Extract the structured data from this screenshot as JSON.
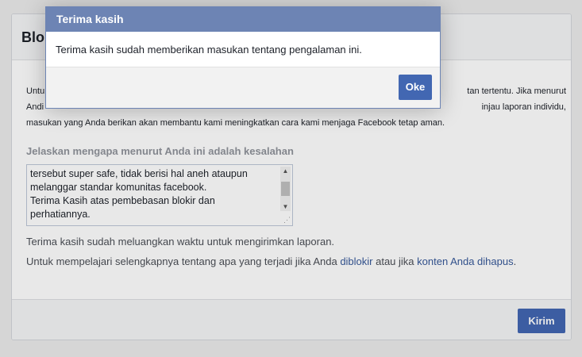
{
  "page": {
    "title": "Blo",
    "description_lines": [
      "Untu",
      "Andi",
      "masukan yang Anda berikan akan membantu kami meningkatkan cara kami menjaga Facebook tetap aman."
    ],
    "description_right": [
      "tan tertentu. Jika menurut",
      "injau laporan individu,"
    ],
    "field_label": "Jelaskan mengapa menurut Anda ini adalah kesalahan",
    "textarea_lines": [
      "tersebut super safe, tidak berisi hal aneh ataupun",
      "melanggar standar komunitas facebook.",
      "Terima Kasih atas pembebasan blokir dan",
      "perhatiannya."
    ],
    "thanks_text": "Terima kasih sudah meluangkan waktu untuk mengirimkan laporan.",
    "learn_more": {
      "prefix": "Untuk mempelajari selengkapnya tentang apa yang terjadi jika Anda ",
      "link1": "diblokir",
      "middle": " atau jika ",
      "link2": "konten Anda dihapus",
      "suffix": "."
    },
    "submit_label": "Kirim"
  },
  "dialog": {
    "title": "Terima kasih",
    "message": "Terima kasih sudah memberikan masukan tentang pengalaman ini.",
    "ok_label": "Oke"
  },
  "icons": {
    "scroll_up": "▲",
    "scroll_down": "▼",
    "resize_grip": "⋰"
  },
  "colors": {
    "primary_button": "#4267b2",
    "dialog_header": "#6d84b4",
    "link": "#365899"
  }
}
